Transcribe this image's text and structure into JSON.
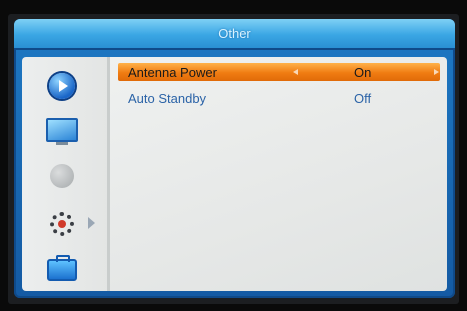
{
  "header": {
    "title": "Other"
  },
  "sidebar": {
    "icons": [
      "play-icon",
      "monitor-icon",
      "globe-icon",
      "gear-icon",
      "briefcase-icon"
    ]
  },
  "settings": [
    {
      "label": "Antenna Power",
      "value": "On"
    },
    {
      "label": "Auto Standby",
      "value": "Off"
    }
  ],
  "colors": {
    "accent": "#1e79c4",
    "highlight": "#f07c12",
    "text": "#2b63a7"
  }
}
